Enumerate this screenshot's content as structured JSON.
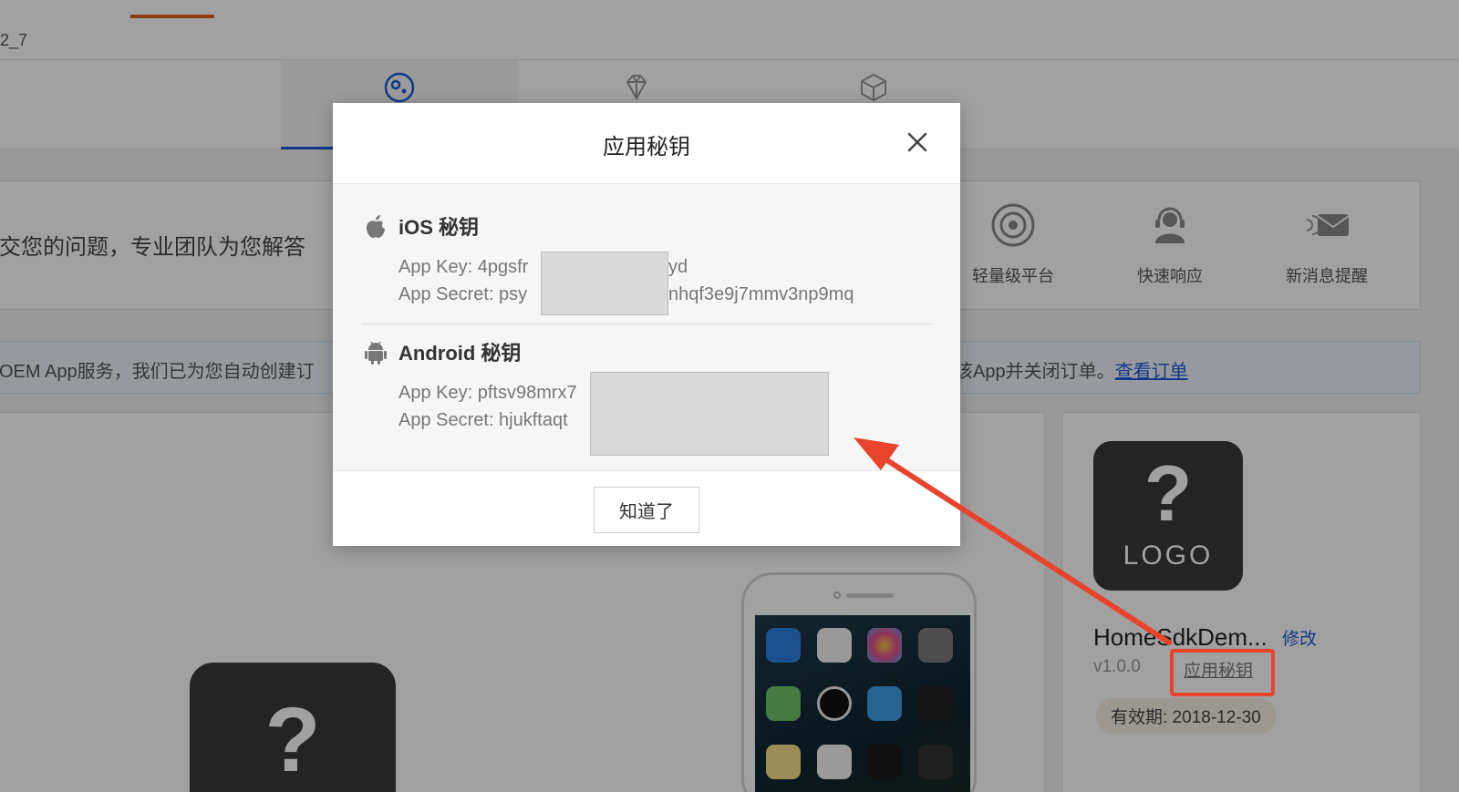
{
  "header": {
    "crumb": "2_7"
  },
  "tabs": [
    {
      "icon": "gear-circle-icon",
      "active": true
    },
    {
      "icon": "diamond-icon",
      "active": false
    },
    {
      "icon": "cube-icon",
      "active": false
    }
  ],
  "help": {
    "text": "交您的问题，专业团队为您解答",
    "features": [
      {
        "icon": "target-icon",
        "label": "轻量级平台"
      },
      {
        "icon": "headset-user-icon",
        "label": "快速响应"
      },
      {
        "icon": "envelope-icon",
        "label": "新消息提醒"
      }
    ]
  },
  "notice": {
    "left": "OEM App服务，我们已为您自动创建订",
    "right": "该App并关闭订单。",
    "link": "查看订单"
  },
  "app": {
    "logo_mark": "?",
    "logo_text": "LOGO",
    "name": "HomeSdkDem...",
    "edit": "修改",
    "version": "v1.0.0",
    "secret_link": "应用秘钥",
    "validity": "有效期: 2018-12-30"
  },
  "placeholder_logo_mark": "?",
  "modal": {
    "title": "应用秘钥",
    "ios": {
      "heading": "iOS 秘钥",
      "key_visible_start": "App Key: 4pgsfr",
      "key_visible_end": "yd",
      "secret_visible_start": "App Secret: psy",
      "secret_visible_end": "nhqf3e9j7mmv3np9mq"
    },
    "android": {
      "heading": "Android 秘钥",
      "key_visible_start": "App Key: pftsv98mrx7",
      "secret_visible_start": "App Secret: hjukftaqt"
    },
    "ok_label": "知道了"
  },
  "colors": {
    "accent_orange": "#e0631e",
    "link_blue": "#1e5bd6",
    "highlight_red": "#e8432d"
  }
}
